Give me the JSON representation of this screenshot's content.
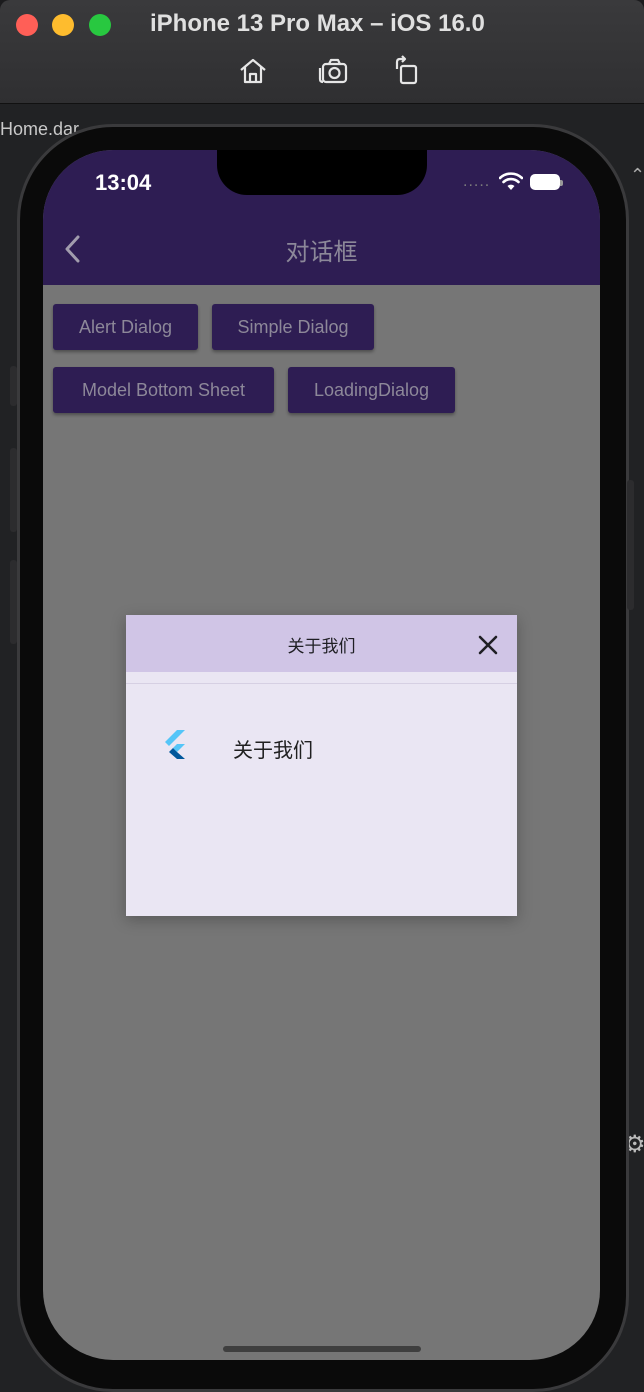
{
  "window": {
    "title": "iPhone 13 Pro Max – iOS 16.0",
    "tools": [
      "home-icon",
      "screenshot-icon",
      "rotate-icon"
    ]
  },
  "ide": {
    "tab_label": "Home.dar"
  },
  "status_bar": {
    "time": "13:04",
    "signal": "....."
  },
  "app_bar": {
    "back_icon": "chevron-left-icon",
    "title": "对话框"
  },
  "buttons": [
    {
      "label": "Alert Dialog"
    },
    {
      "label": "Simple Dialog"
    },
    {
      "label": "Model Bottom Sheet"
    },
    {
      "label": "LoadingDialog"
    }
  ],
  "dialog": {
    "title": "关于我们",
    "close_icon": "close-icon",
    "item": {
      "icon": "flutter-logo-icon",
      "text": "关于我们"
    }
  },
  "colors": {
    "app_bar": "#2e1d53",
    "scrim": "#767676",
    "dialog_header": "#d0c5e6",
    "dialog_body": "#eae6f3"
  }
}
